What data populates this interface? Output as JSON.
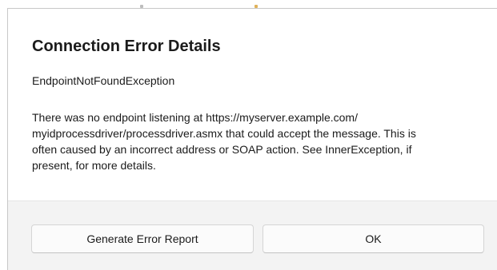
{
  "dialog": {
    "title": "Connection Error Details",
    "exception_type": "EndpointNotFoundException",
    "message_lines": [
      "There was no endpoint listening at https://myserver.example.com/",
      "myidprocessdriver/processdriver.asmx that could accept the message. This is",
      "often caused by an incorrect address or SOAP action. See InnerException, if",
      "present, for more details."
    ]
  },
  "buttons": {
    "generate_report_label": "Generate Error Report",
    "ok_label": "OK"
  },
  "colors": {
    "footer_background": "#f3f3f3",
    "button_background": "#fbfbfb",
    "text": "#1b1b1b"
  }
}
